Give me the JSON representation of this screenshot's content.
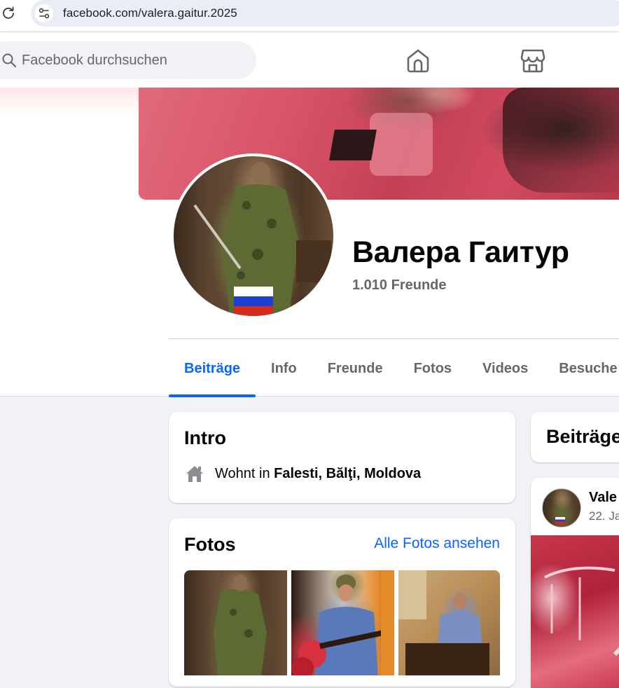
{
  "browser": {
    "url": "facebook.com/valera.gaitur.2025"
  },
  "topbar": {
    "search_placeholder": "Facebook durchsuchen"
  },
  "profile": {
    "name": "Валера Гаитур",
    "friends": "1.010 Freunde"
  },
  "tabs": [
    {
      "label": "Beiträge",
      "active": true
    },
    {
      "label": "Info"
    },
    {
      "label": "Freunde"
    },
    {
      "label": "Fotos"
    },
    {
      "label": "Videos"
    },
    {
      "label": "Besuche"
    }
  ],
  "intro": {
    "title": "Intro",
    "lives_prefix": "Wohnt in",
    "lives_location": "Falesti, Bălţi, Moldova"
  },
  "photos": {
    "title": "Fotos",
    "all_link": "Alle Fotos ansehen"
  },
  "posts": {
    "title": "Beiträge",
    "author_partial": "Vale",
    "date_partial": "22. Ja"
  },
  "colors": {
    "accent": "#0866ff",
    "secondary_text": "#65676b",
    "background": "#f0f2f5",
    "flag_white": "#ffffff",
    "flag_blue": "#1c3fd0",
    "flag_red": "#d52b1e"
  }
}
